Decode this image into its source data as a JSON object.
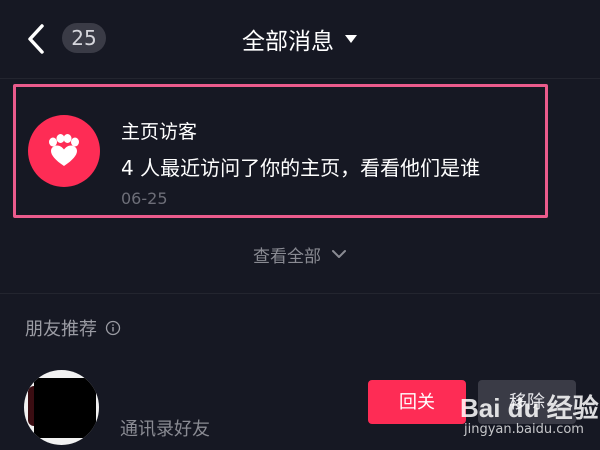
{
  "header": {
    "back_icon": "chevron-left-icon",
    "unread_count": "25",
    "title": "全部消息",
    "dropdown_icon": "caret-down-icon"
  },
  "visitor_card": {
    "icon": "paw-heart-icon",
    "icon_color": "#fe2c55",
    "highlight_color": "#ea5b8c",
    "title": "主页访客",
    "body": "4 人最近访问了你的主页，看看他们是谁",
    "date": "06-25"
  },
  "view_all": {
    "label": "查看全部",
    "icon": "chevron-down-icon"
  },
  "friend_recommend": {
    "section_title": "朋友推荐",
    "info_icon": "info-icon",
    "items": [
      {
        "subtitle": "通讯录好友",
        "follow_back_label": "回关",
        "remove_label": "移除"
      }
    ]
  },
  "watermark": {
    "logo": "Bai du 经验",
    "url": "jingyan.baidu.com"
  },
  "colors": {
    "background": "#161823",
    "accent": "#fe2c55",
    "secondary_button": "#3a3b46"
  }
}
